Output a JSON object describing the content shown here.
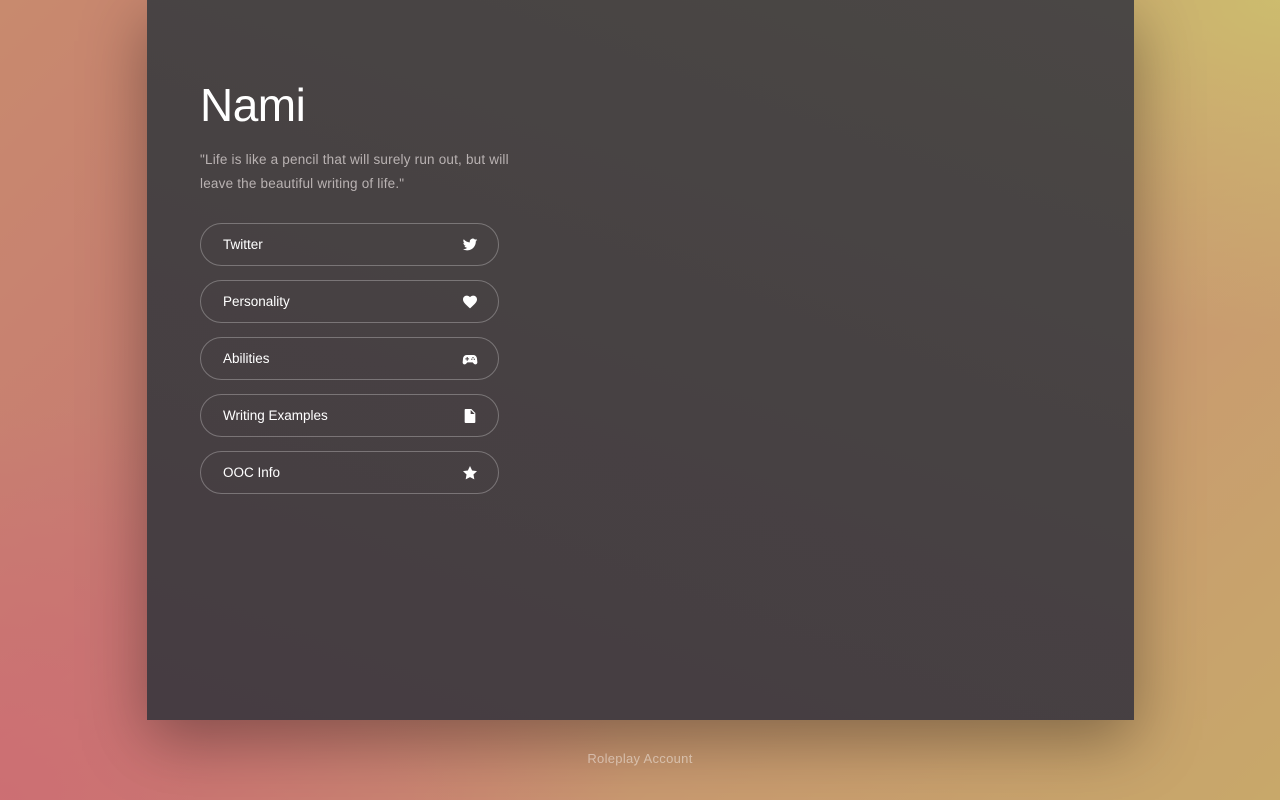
{
  "profile": {
    "name": "Nami",
    "quote": "\"Life is like a pencil that will surely run out, but will leave the beautiful writing of life.\""
  },
  "nav": {
    "items": [
      {
        "label": "Twitter",
        "icon": "twitter-icon"
      },
      {
        "label": "Personality",
        "icon": "heart-icon"
      },
      {
        "label": "Abilities",
        "icon": "gamepad-icon"
      },
      {
        "label": "Writing Examples",
        "icon": "document-icon"
      },
      {
        "label": "OOC Info",
        "icon": "star-icon"
      }
    ]
  },
  "footer": {
    "text": "Roleplay Account"
  },
  "colors": {
    "panel": "#474243",
    "text": "#ffffff",
    "quote": "#b9b2b2"
  }
}
